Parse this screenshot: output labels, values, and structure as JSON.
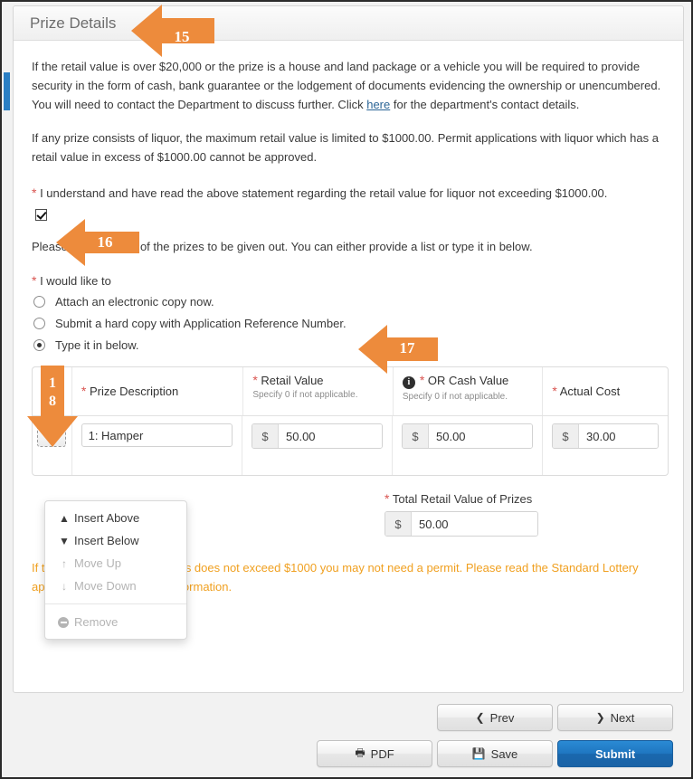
{
  "panel": {
    "title": "Prize Details"
  },
  "paragraphs": {
    "p1_part1": "If the retail value is over $20,000 or the prize is a house and land package or a vehicle you will be required to provide security in the form of cash, bank guarantee or the lodgement of documents evidencing the ownership or unencumbered. You will need to contact the Department to discuss further. Click ",
    "p1_link": "here",
    "p1_part2": " for the department's contact details.",
    "p2": "If any prize consists of liquor, the maximum retail value is limited to $1000.00. Permit applications with liquor which has a retail value in excess of $1000.00 cannot be approved.",
    "p3": "Please provide a list of the prizes to be given out. You can either provide a list or type it in below."
  },
  "consent": {
    "label": "I understand and have read the above statement regarding the retail value for liquor not exceeding $1000.00.",
    "checked": true
  },
  "choice": {
    "label": "I would like to",
    "options": [
      {
        "label": "Attach an electronic copy now.",
        "selected": false
      },
      {
        "label": "Submit a hard copy with Application Reference Number.",
        "selected": false
      },
      {
        "label": "Type it in below.",
        "selected": true
      }
    ]
  },
  "prize_table": {
    "headers": {
      "description": "Prize Description",
      "retail_value": "Retail Value",
      "retail_value_hint": "Specify 0 if not applicable.",
      "cash_value": "OR Cash Value",
      "cash_value_hint": "Specify 0 if not applicable.",
      "actual_cost": "Actual Cost"
    },
    "rows": [
      {
        "description": "1: Hamper",
        "retail_value": "50.00",
        "cash_value": "50.00",
        "actual_cost": "30.00",
        "currency_symbol": "$"
      }
    ]
  },
  "row_menu": {
    "items": [
      {
        "label": "Insert Above",
        "icon": "chevron-up",
        "disabled": false
      },
      {
        "label": "Insert Below",
        "icon": "chevron-down",
        "disabled": false
      },
      {
        "label": "Move Up",
        "icon": "arrow-up",
        "disabled": true
      },
      {
        "label": "Move Down",
        "icon": "arrow-down",
        "disabled": true
      },
      {
        "label": "Remove",
        "icon": "minus-circle",
        "disabled": true
      }
    ]
  },
  "total": {
    "label": "Total Retail Value of Prizes",
    "currency_symbol": "$",
    "value": "50.00"
  },
  "warning": {
    "text": "If the total retail value of prizes does not exceed $1000 you may not need a permit. Please read the Standard Lottery application guide for more information."
  },
  "buttons": {
    "prev": "Prev",
    "next": "Next",
    "pdf": "PDF",
    "save": "Save",
    "submit": "Submit"
  },
  "annotations": [
    {
      "id": "15",
      "label": "15",
      "direction": "left"
    },
    {
      "id": "16",
      "label": "16",
      "direction": "left"
    },
    {
      "id": "17",
      "label": "17",
      "direction": "left"
    },
    {
      "id": "18",
      "label": "18",
      "direction": "down"
    }
  ],
  "colors": {
    "accent_orange": "#ED8B3C",
    "submit_blue": "#1F76C0",
    "warning_orange": "#F0A020",
    "required_red": "#D9534F",
    "left_tab_blue": "#2A7FC4"
  }
}
